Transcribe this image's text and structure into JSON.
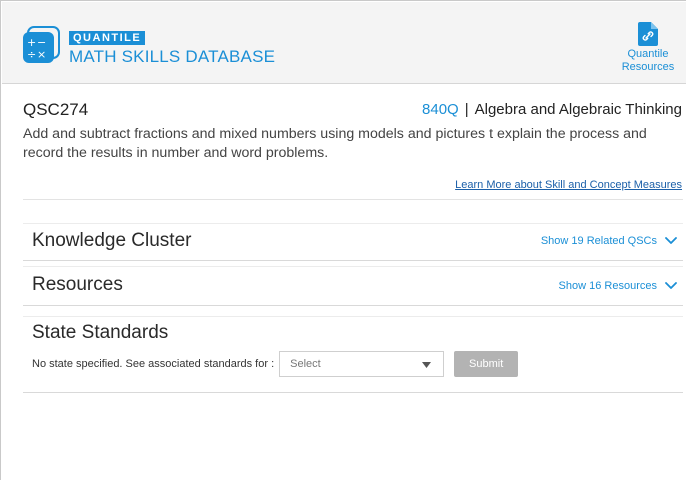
{
  "header": {
    "brand_tag": "QUANTILE",
    "brand_title": "MATH SKILLS DATABASE",
    "resources_line1": "Quantile",
    "resources_line2": "Resources"
  },
  "skill": {
    "id": "QSC274",
    "measure": "840Q",
    "separator": "|",
    "strand": "Algebra and Algebraic Thinking",
    "description": "Add and subtract fractions and mixed numbers using models and pictures t explain the process and record the results in number and word problems.",
    "learn_more": "Learn More about Skill and Concept Measures"
  },
  "panels": {
    "knowledge_cluster": {
      "title": "Knowledge Cluster",
      "toggle": "Show 19 Related QSCs"
    },
    "resources": {
      "title": "Resources",
      "toggle": "Show 16 Resources"
    },
    "state_standards": {
      "title": "State Standards",
      "label": "No state specified. See associated standards for :",
      "select_value": "Select",
      "submit": "Submit"
    }
  },
  "icons": {
    "logo": "math-operators-icon",
    "resources": "document-link-icon",
    "toggle": "chevron-down-icon",
    "select": "caret-down-icon"
  },
  "colors": {
    "brand": "#1b8fd6",
    "header_bg": "#f4f4f4",
    "submit_disabled": "#b3b3b3"
  }
}
